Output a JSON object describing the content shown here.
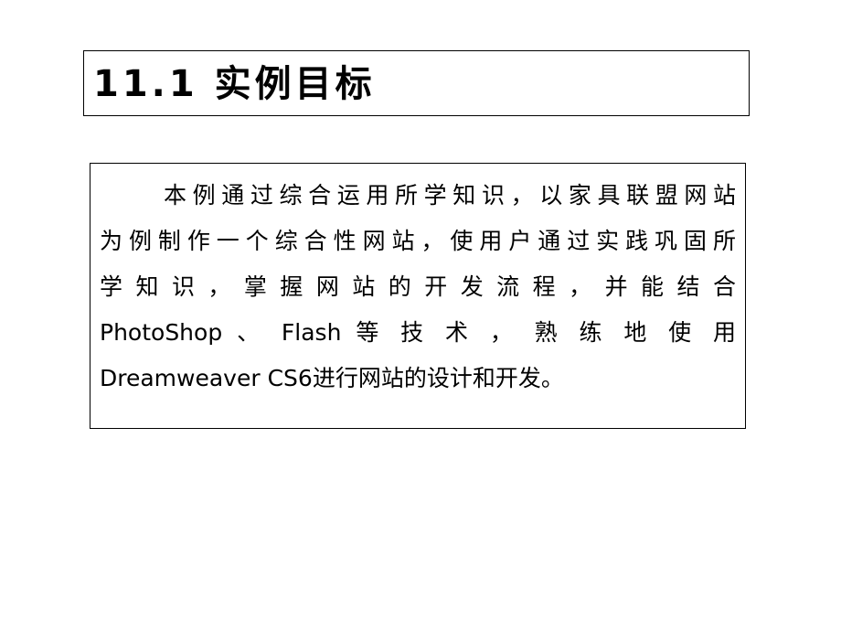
{
  "slide": {
    "title": "11.1 实例目标",
    "body_lines": [
      "本例通过综合运用所学知识，以家具联盟网站",
      "为例制作一个综合性网站，使用户通过实践巩固所",
      "学 知 识 ， 掌 握 网 站 的 开 发 流 程 ， 并 能 结 合",
      "PhotoShop 、 Flash 等 技 术 ， 熟 练 地 使 用",
      "Dreamweaver CS6进行网站的设计和开发。"
    ]
  }
}
